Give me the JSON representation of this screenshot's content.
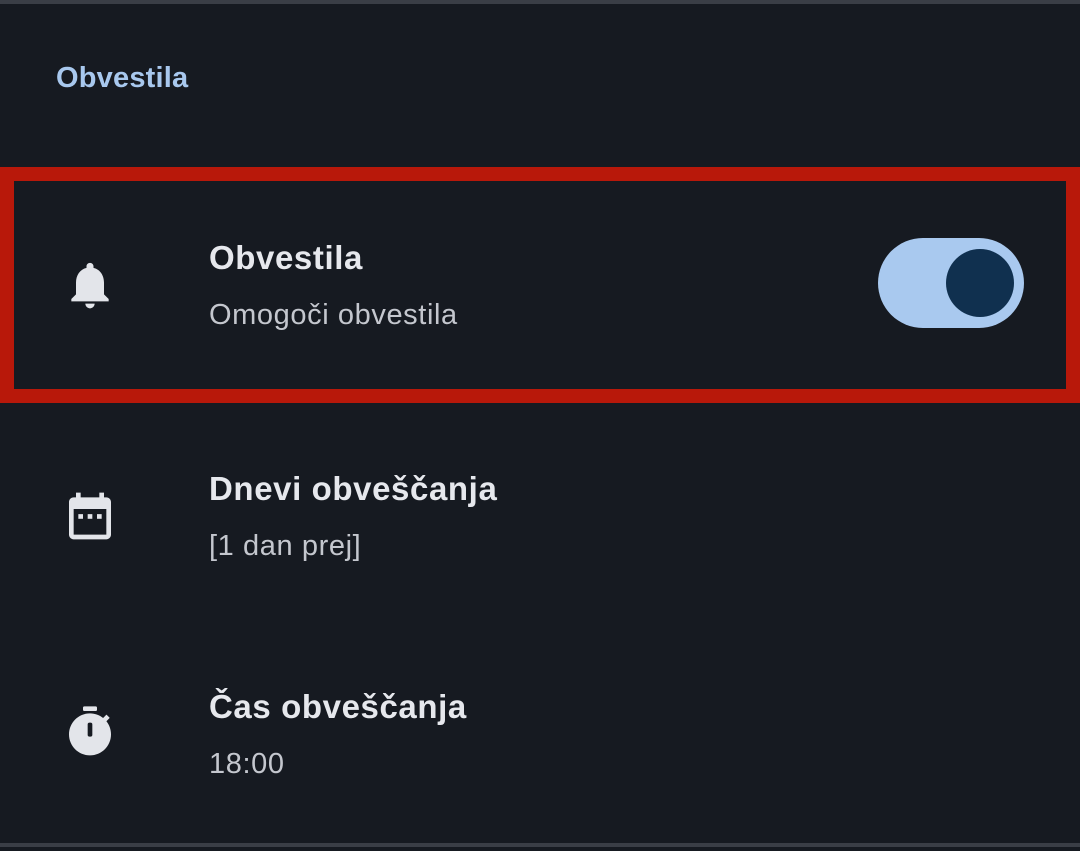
{
  "section": {
    "title": "Obvestila"
  },
  "rows": [
    {
      "icon": "bell-icon",
      "title": "Obvestila",
      "subtitle": "Omogoči obvestila",
      "toggle_on": true
    },
    {
      "icon": "calendar-icon",
      "title": "Dnevi obveščanja",
      "subtitle": "[1 dan prej]"
    },
    {
      "icon": "timer-icon",
      "title": "Čas obveščanja",
      "subtitle": "18:00"
    }
  ],
  "colors": {
    "background": "#161a21",
    "accent": "#a8c8ee",
    "toggle_track": "#a9c9ef",
    "toggle_thumb": "#10304f",
    "highlight_border": "#b8180a"
  }
}
